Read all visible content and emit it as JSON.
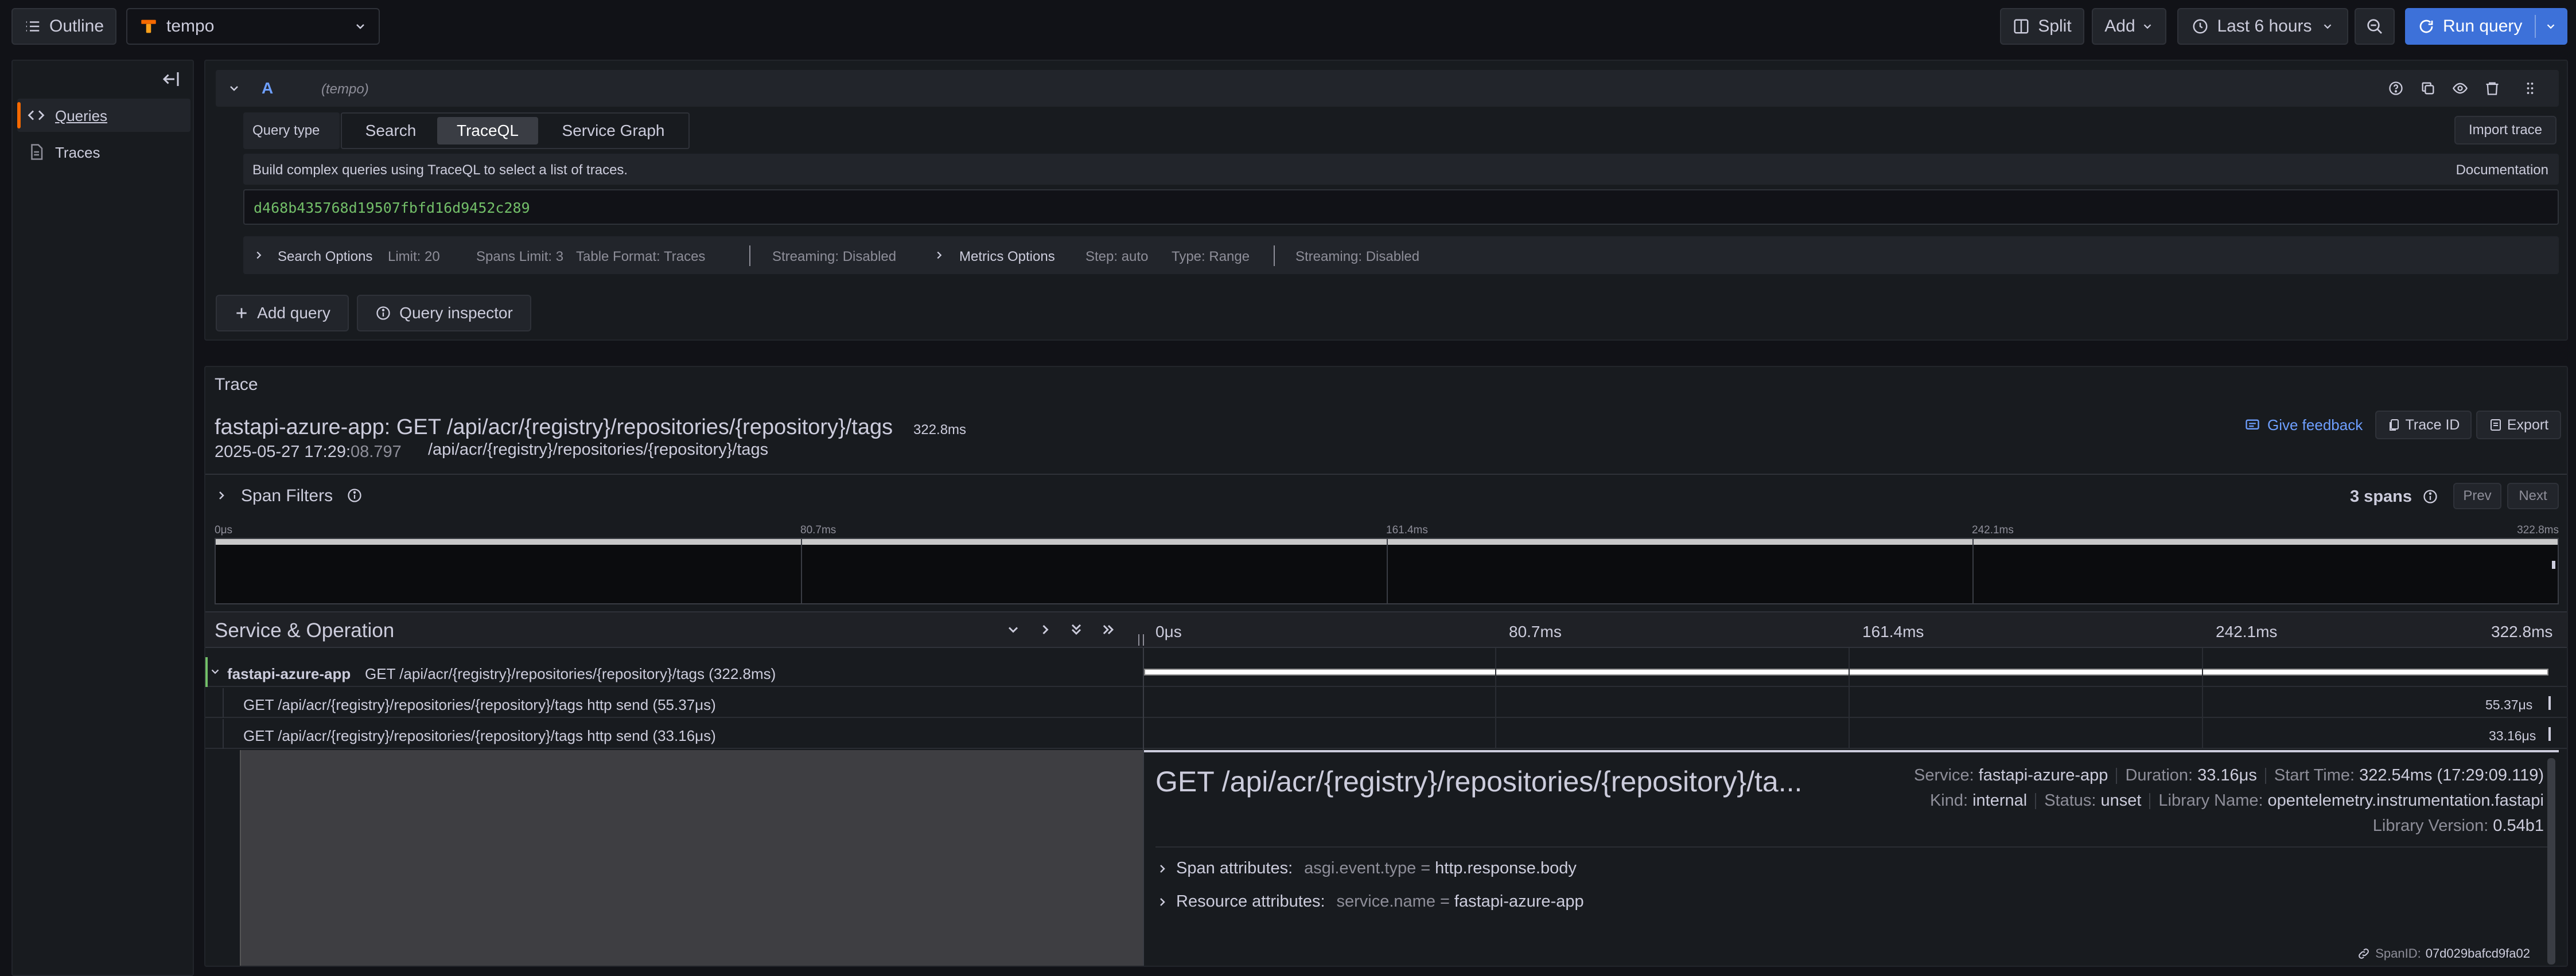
{
  "toolbar": {
    "outline_label": "Outline",
    "datasource_name": "tempo",
    "split_label": "Split",
    "add_label": "Add",
    "time_range_label": "Last 6 hours",
    "run_query_label": "Run query"
  },
  "sidebar": {
    "items": [
      {
        "label": "Queries",
        "icon": "code-icon",
        "active": true
      },
      {
        "label": "Traces",
        "icon": "document-icon",
        "active": false
      }
    ]
  },
  "query_row": {
    "ref_id": "A",
    "datasource": "(tempo)",
    "query_type_label": "Query type",
    "query_types": [
      "Search",
      "TraceQL",
      "Service Graph"
    ],
    "selected_query_type": "TraceQL",
    "import_trace_label": "Import trace",
    "help_text": "Build complex queries using TraceQL to select a list of traces.",
    "documentation_label": "Documentation",
    "query_value": "d468b435768d19507fbfd16d9452c289",
    "search_options": {
      "label": "Search Options",
      "limit": "Limit: 20",
      "spans_limit": "Spans Limit: 3",
      "table_format": "Table Format: Traces",
      "streaming": "Streaming: Disabled"
    },
    "metrics_options": {
      "label": "Metrics Options",
      "step": "Step: auto",
      "type": "Type: Range",
      "streaming": "Streaming: Disabled"
    }
  },
  "actions": {
    "add_query_label": "Add query",
    "query_inspector_label": "Query inspector"
  },
  "trace": {
    "panel_title": "Trace",
    "title": "fastapi-azure-app: GET /api/acr/{registry}/repositories/{repository}/tags",
    "duration": "322.8ms",
    "date": "2025-05-27 17:29:",
    "seconds": "08.797",
    "url": "/api/acr/{registry}/repositories/{repository}/tags",
    "give_feedback_label": "Give feedback",
    "trace_id_label": "Trace ID",
    "export_label": "Export",
    "span_filters_label": "Span Filters",
    "spans_count": "3 spans",
    "prev_label": "Prev",
    "next_label": "Next",
    "minimap_ticks": [
      "0μs",
      "80.7ms",
      "161.4ms",
      "242.1ms",
      "322.8ms"
    ],
    "header_service_op": "Service & Operation",
    "header_ticks": [
      "0μs",
      "80.7ms",
      "161.4ms",
      "242.1ms",
      "322.8ms"
    ],
    "spans": [
      {
        "service": "fastapi-azure-app",
        "operation": "GET /api/acr/{registry}/repositories/{repository}/tags (322.8ms)",
        "duration_label": ""
      },
      {
        "service": "",
        "operation": "GET /api/acr/{registry}/repositories/{repository}/tags http send (55.37μs)",
        "duration_label": "55.37μs"
      },
      {
        "service": "",
        "operation": "GET /api/acr/{registry}/repositories/{repository}/tags http send (33.16μs)",
        "duration_label": "33.16μs"
      }
    ],
    "detail": {
      "title": "GET /api/acr/{registry}/repositories/{repository}/ta...",
      "service_key": "Service:",
      "service_val": "fastapi-azure-app",
      "duration_key": "Duration:",
      "duration_val": "33.16μs",
      "start_key": "Start Time:",
      "start_val": "322.54ms (17:29:09.119)",
      "kind_key": "Kind:",
      "kind_val": "internal",
      "status_key": "Status:",
      "status_val": "unset",
      "library_key": "Library Name:",
      "library_val": "opentelemetry.instrumentation.fastapi",
      "version_key": "Library Version:",
      "version_val": "0.54b1",
      "span_attr_label": "Span attributes:",
      "span_attr_key": "asgi.event.type",
      "span_attr_eq": "=",
      "span_attr_val": "http.response.body",
      "res_attr_label": "Resource attributes:",
      "res_attr_key": "service.name",
      "res_attr_eq": "=",
      "res_attr_val": "fastapi-azure-app",
      "spanid_label": "SpanID:",
      "spanid_val": "07d029bafcd9fa02"
    }
  },
  "colors": {
    "accent": "#3d71d9",
    "link": "#6e9fff",
    "bg": "#111217",
    "panel": "#181b1f",
    "span_green": "#73bf69"
  }
}
